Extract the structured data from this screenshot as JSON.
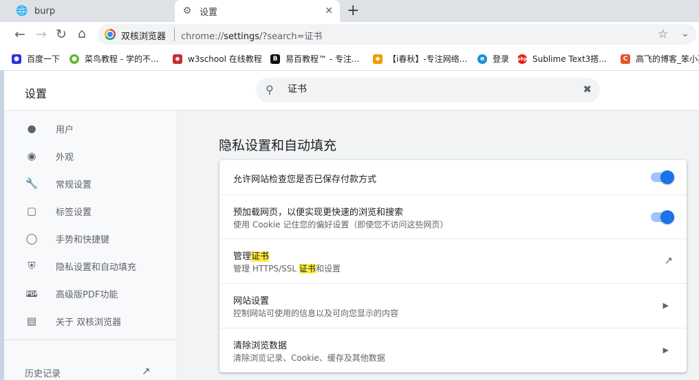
{
  "tabs": [
    {
      "title": "burp",
      "icon": "globe-icon"
    },
    {
      "title": "设置",
      "icon": "gear-icon",
      "active": true
    }
  ],
  "toolbar": {
    "browser_name": "双核浏览器",
    "url_scheme": "chrome://",
    "url_host": "settings",
    "url_path": "/?search=证书"
  },
  "bookmarks": [
    {
      "label": "百度一下",
      "color": "#2932e1"
    },
    {
      "label": "菜鸟教程 - 学的不...",
      "color": "#5fb832"
    },
    {
      "label": "w3school 在线教程",
      "color": "#c2302d"
    },
    {
      "label": "易百教程™ - 专注...",
      "color": "#111111"
    },
    {
      "label": "【i春秋】-专注网络...",
      "color": "#f29a00"
    },
    {
      "label": "登录",
      "color": "#1a8fd7"
    },
    {
      "label": "Sublime Text3搭...",
      "color": "#e0241b"
    },
    {
      "label": "高飞的博客_笨小孩",
      "color": "#e5532d"
    }
  ],
  "settings": {
    "title": "设置",
    "search_value": "证书"
  },
  "sidebar": {
    "items": [
      {
        "label": "用户",
        "icon": "person-icon"
      },
      {
        "label": "外观",
        "icon": "palette-icon"
      },
      {
        "label": "常规设置",
        "icon": "wrench-icon"
      },
      {
        "label": "标签设置",
        "icon": "tab-icon"
      },
      {
        "label": "手势和快捷键",
        "icon": "mouse-icon"
      },
      {
        "label": "隐私设置和自动填充",
        "icon": "shield-icon"
      },
      {
        "label": "高级版PDF功能",
        "icon": "pdf-icon"
      },
      {
        "label": "关于 双核浏览器",
        "icon": "clipboard-icon"
      }
    ],
    "history_label": "历史记录"
  },
  "main": {
    "section_title": "隐私设置和自动填充",
    "rows": [
      {
        "title": "允许网站检查您是否已保存付款方式",
        "toggle": true
      },
      {
        "title": "预加载网页，以便实现更快速的浏览和搜索",
        "subtitle": "使用 Cookie 记住您的偏好设置（即使您不访问这些网页）",
        "toggle": true
      },
      {
        "title_pre": "管理",
        "title_mark": "证书",
        "subtitle_pre": "管理 HTTPS/SSL ",
        "subtitle_mark": "证书",
        "subtitle_post": "和设置"
      },
      {
        "title": "网站设置",
        "subtitle": "控制网站可使用的信息以及可向您显示的内容"
      },
      {
        "title": "清除浏览数据",
        "subtitle": "清除浏览记录、Cookie、缓存及其他数据"
      }
    ]
  },
  "colors": {
    "accent": "#1a73e8",
    "highlight": "#ffeb3b"
  }
}
